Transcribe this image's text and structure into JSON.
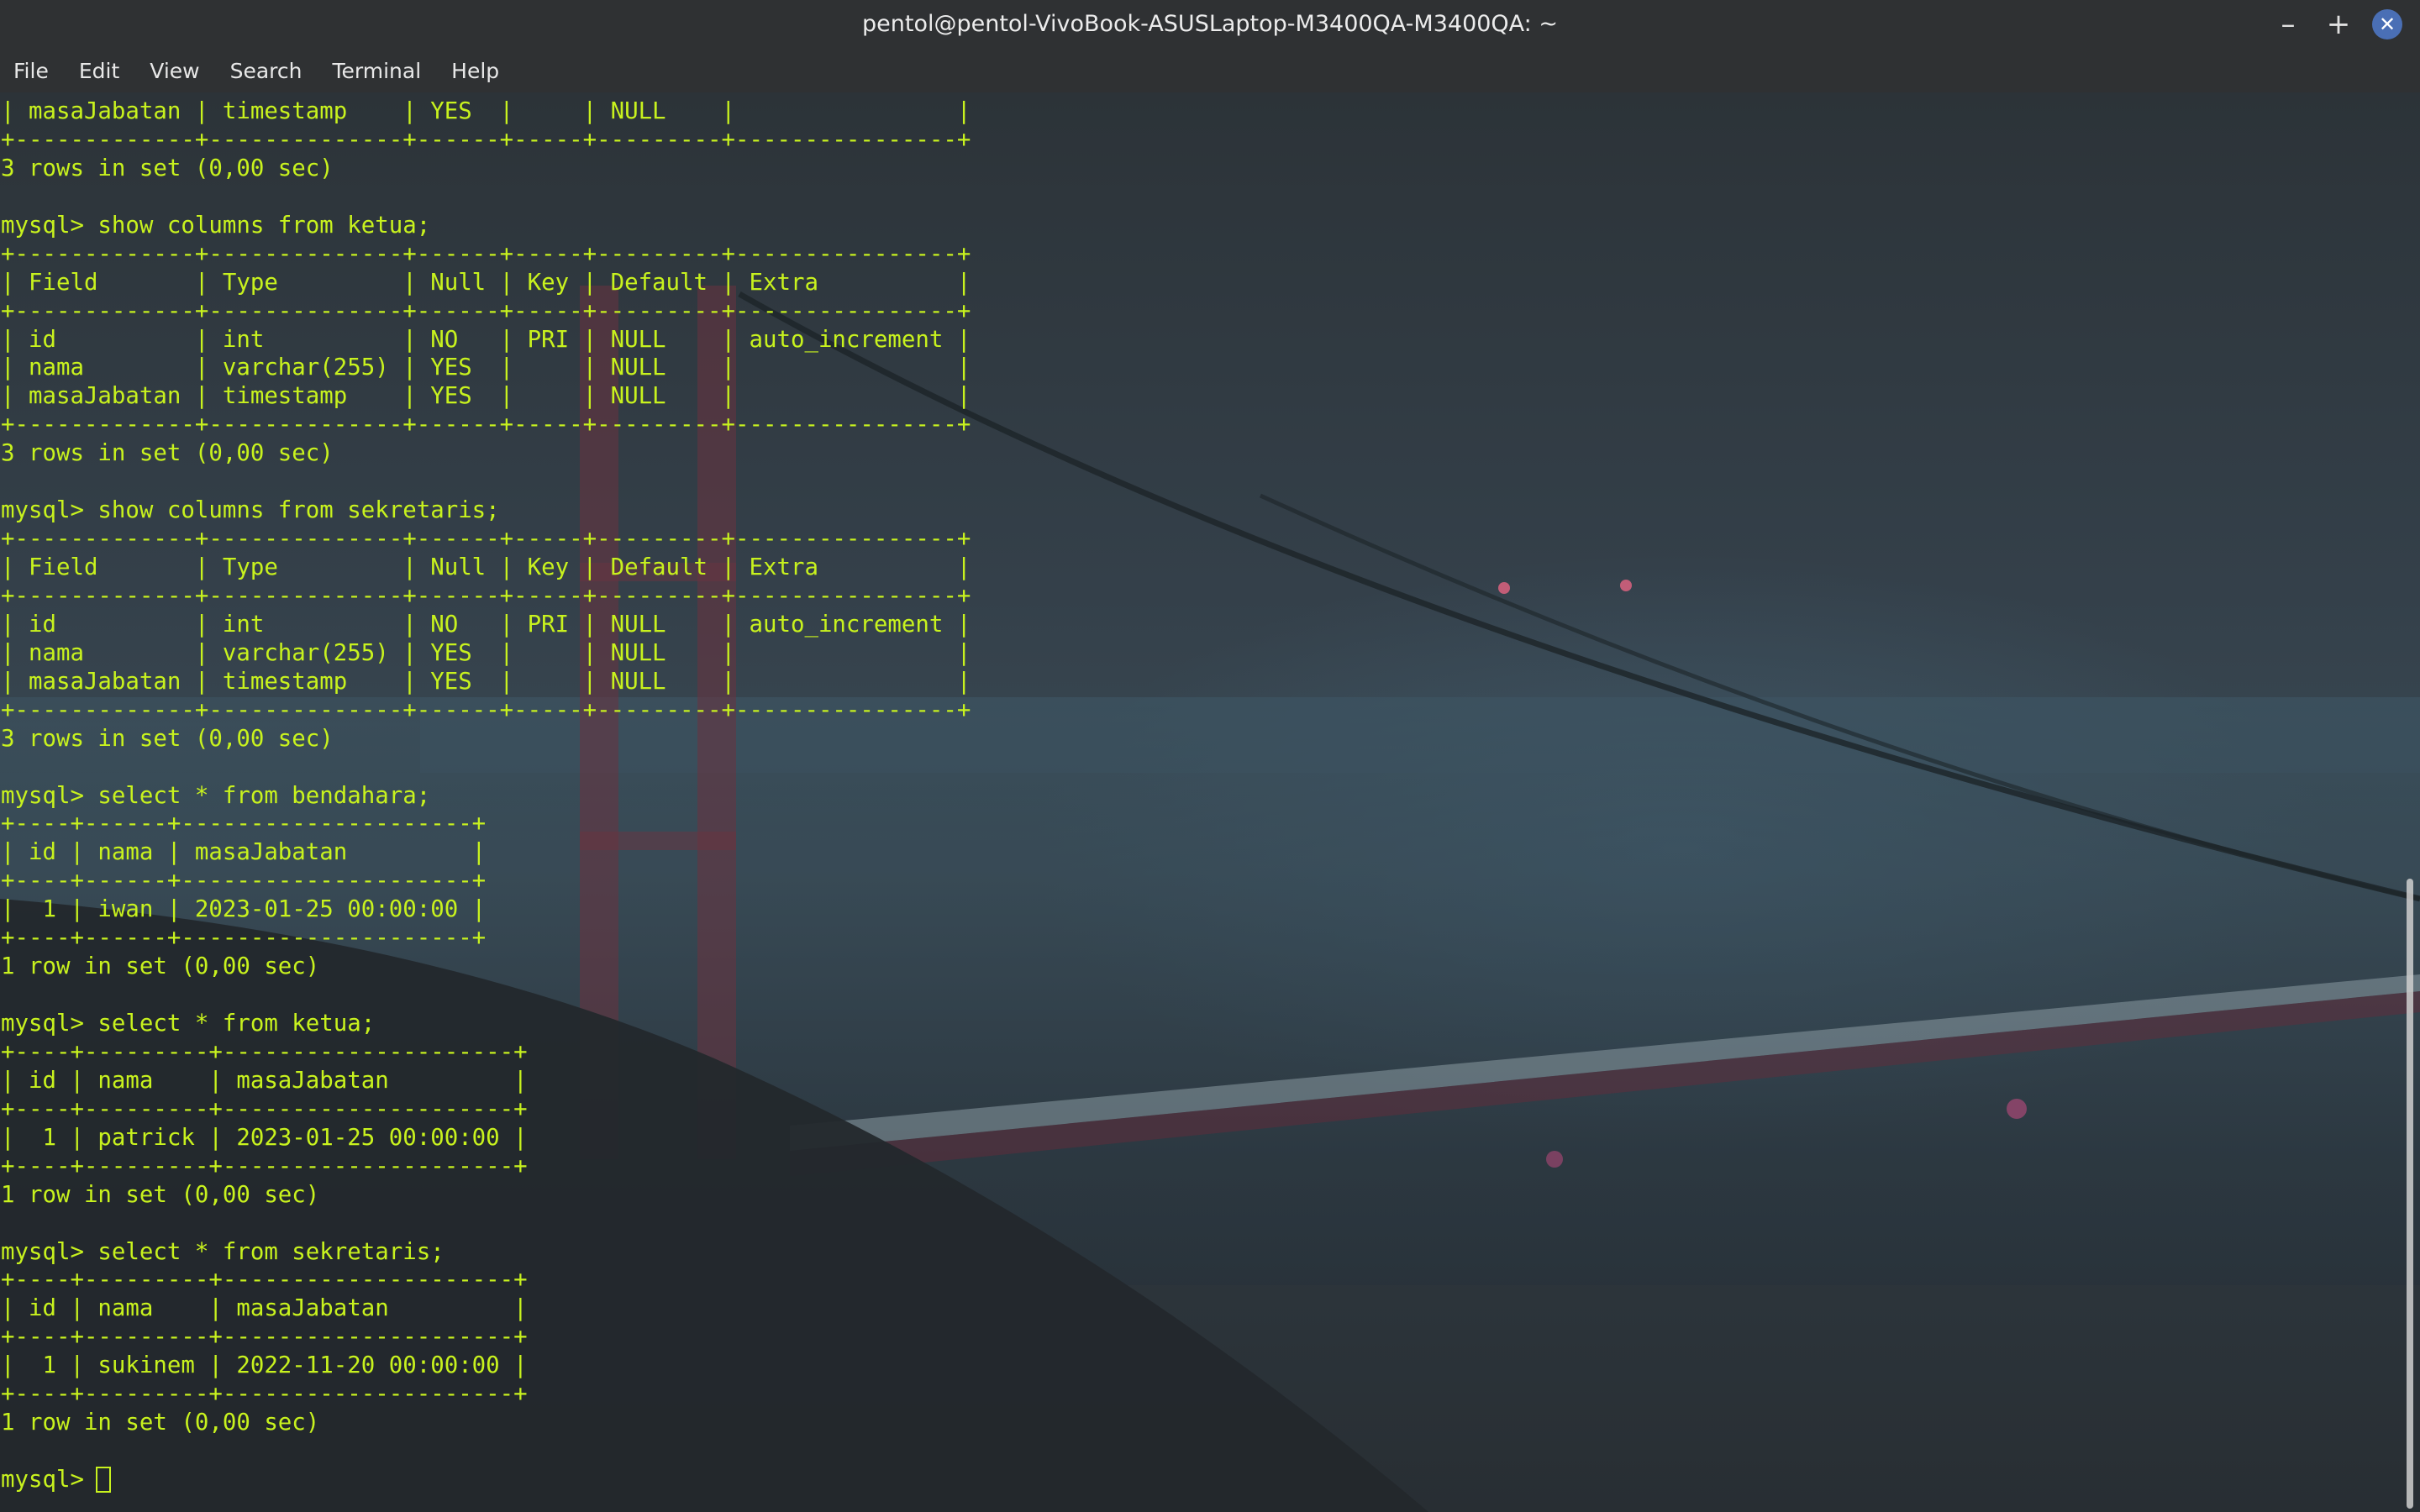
{
  "window": {
    "title": "pentol@pentol-VivoBook-ASUSLaptop-M3400QA-M3400QA: ~",
    "minimize_icon": "minimize-icon",
    "maximize_icon": "maximize-icon",
    "close_icon": "close-icon"
  },
  "menu": {
    "items": [
      "File",
      "Edit",
      "View",
      "Search",
      "Terminal",
      "Help"
    ]
  },
  "colors": {
    "terminal_text": "#c8f21e",
    "titlebar_bg": "#2f3133",
    "close_button": "#4a6fb5"
  },
  "terminal": {
    "lines": [
      "| masaJabatan | timestamp    | YES  |     | NULL    |                |",
      "+-------------+--------------+------+-----+---------+----------------+",
      "3 rows in set (0,00 sec)",
      "",
      "mysql> show columns from ketua;",
      "+-------------+--------------+------+-----+---------+----------------+",
      "| Field       | Type         | Null | Key | Default | Extra          |",
      "+-------------+--------------+------+-----+---------+----------------+",
      "| id          | int          | NO   | PRI | NULL    | auto_increment |",
      "| nama        | varchar(255) | YES  |     | NULL    |                |",
      "| masaJabatan | timestamp    | YES  |     | NULL    |                |",
      "+-------------+--------------+------+-----+---------+----------------+",
      "3 rows in set (0,00 sec)",
      "",
      "mysql> show columns from sekretaris;",
      "+-------------+--------------+------+-----+---------+----------------+",
      "| Field       | Type         | Null | Key | Default | Extra          |",
      "+-------------+--------------+------+-----+---------+----------------+",
      "| id          | int          | NO   | PRI | NULL    | auto_increment |",
      "| nama        | varchar(255) | YES  |     | NULL    |                |",
      "| masaJabatan | timestamp    | YES  |     | NULL    |                |",
      "+-------------+--------------+------+-----+---------+----------------+",
      "3 rows in set (0,00 sec)",
      "",
      "mysql> select * from bendahara;",
      "+----+------+---------------------+",
      "| id | nama | masaJabatan         |",
      "+----+------+---------------------+",
      "|  1 | iwan | 2023-01-25 00:00:00 |",
      "+----+------+---------------------+",
      "1 row in set (0,00 sec)",
      "",
      "mysql> select * from ketua;",
      "+----+---------+---------------------+",
      "| id | nama    | masaJabatan         |",
      "+----+---------+---------------------+",
      "|  1 | patrick | 2023-01-25 00:00:00 |",
      "+----+---------+---------------------+",
      "1 row in set (0,00 sec)",
      "",
      "mysql> select * from sekretaris;",
      "+----+---------+---------------------+",
      "| id | nama    | masaJabatan         |",
      "+----+---------+---------------------+",
      "|  1 | sukinem | 2022-11-20 00:00:00 |",
      "+----+---------+---------------------+",
      "1 row in set (0,00 sec)",
      ""
    ],
    "prompt": "mysql>"
  }
}
